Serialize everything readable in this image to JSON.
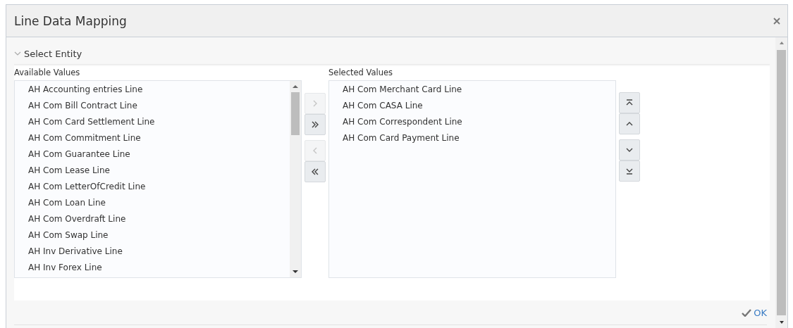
{
  "window": {
    "title": "Line Data Mapping"
  },
  "section": {
    "label": "Select Entity",
    "expanded": true
  },
  "available": {
    "label": "Available Values",
    "items": [
      "AH Accounting entries Line",
      "AH Com Bill Contract Line",
      "AH Com Card Settlement Line",
      "AH Com Commitment Line",
      "AH Com Guarantee Line",
      "AH Com Lease Line",
      "AH Com LetterOfCredit Line",
      "AH Com Loan Line",
      "AH Com Overdraft Line",
      "AH Com Swap Line",
      "AH Inv Derivative Line",
      "AH Inv Forex Line"
    ]
  },
  "shuttle_buttons": [
    {
      "kind": "move",
      "disabled": true
    },
    {
      "kind": "move-all",
      "disabled": false
    },
    {
      "kind": "remove",
      "disabled": true
    },
    {
      "kind": "remove-all",
      "disabled": false
    }
  ],
  "selected": {
    "label": "Selected Values",
    "items": [
      "AH Com Merchant Card Line",
      "AH Com CASA Line",
      "AH Com Correspondent Line",
      "AH Com Card Payment Line"
    ]
  },
  "reorder_buttons": [
    {
      "kind": "top",
      "disabled": false
    },
    {
      "kind": "up",
      "disabled": false
    },
    {
      "kind": "down",
      "disabled": false
    },
    {
      "kind": "bottom",
      "disabled": false
    }
  ],
  "ok_button": {
    "label": "OK"
  }
}
